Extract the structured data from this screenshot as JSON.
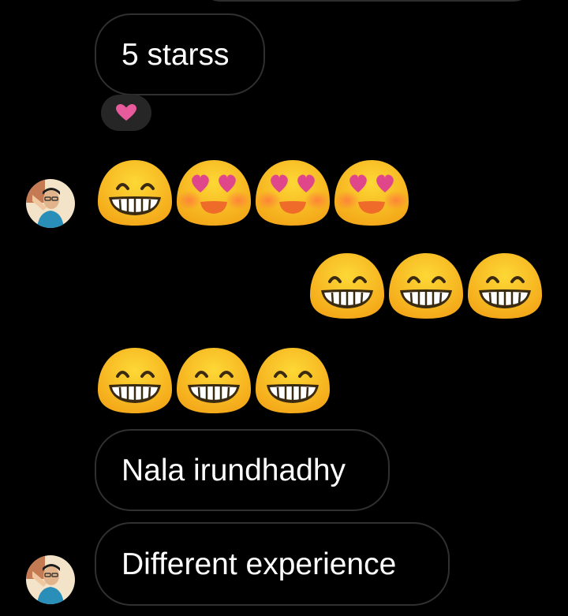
{
  "messages": {
    "five_stars": "5 starss",
    "nala": "Nala irundhadhy",
    "different": "Different experience"
  },
  "reaction": {
    "icon": "heart-icon",
    "color": "#e75a9c"
  },
  "emoji_rows": {
    "row1": [
      "grinning-face-icon",
      "heart-eyes-face-icon",
      "heart-eyes-face-icon",
      "heart-eyes-face-icon"
    ],
    "row2": [
      "grinning-face-icon",
      "grinning-face-icon",
      "grinning-face-icon"
    ],
    "row3": [
      "grinning-face-icon",
      "grinning-face-icon",
      "grinning-face-icon"
    ]
  },
  "colors": {
    "background": "#000000",
    "bubble_border": "#303030",
    "emoji_yellow": "#f9b81c",
    "heart_pink": "#e75a9c"
  }
}
